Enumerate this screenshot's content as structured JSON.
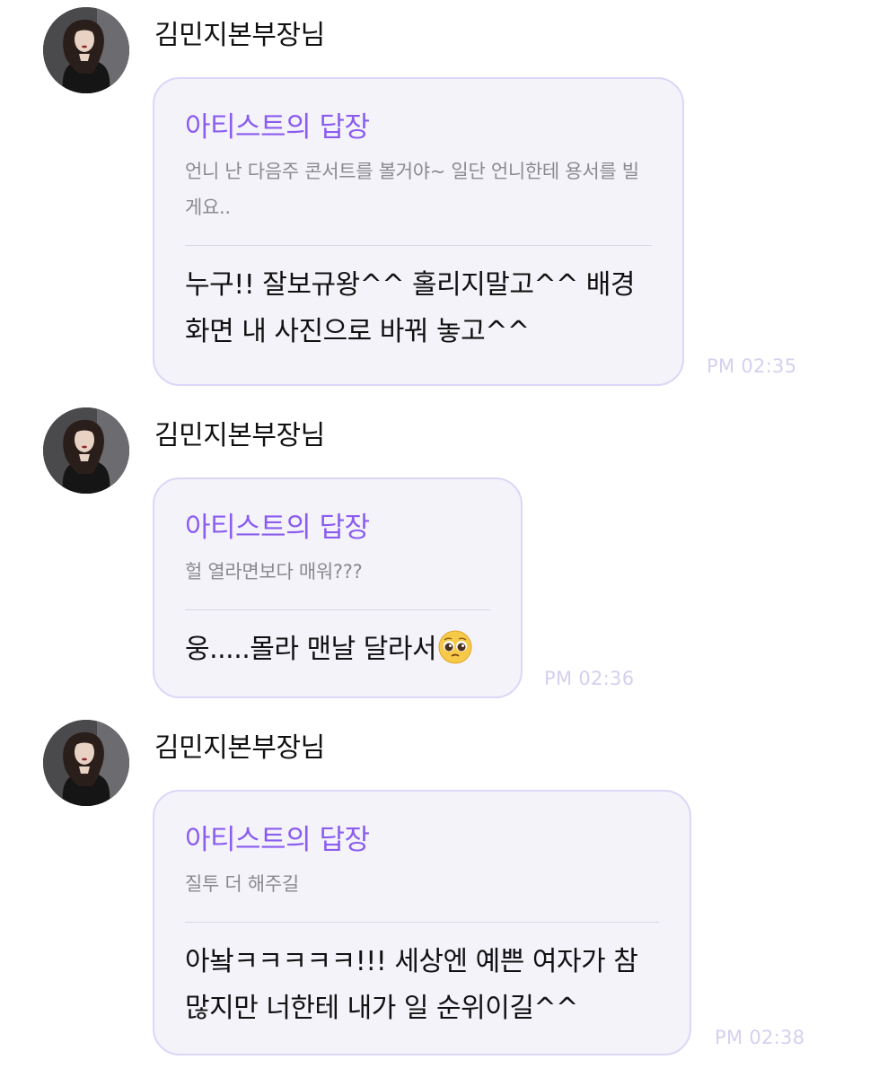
{
  "messages": [
    {
      "sender": "김민지본부장님",
      "reply_title": "아티스트의 답장",
      "quote": "언니 난 다음주 콘서트를 볼거야~ 일단 언니한테 용서를 빌게요..",
      "text": "누구!! 잘보규왕^^ 홀리지말고^^ 배경화면 내 사진으로 바꿔 놓고^^",
      "time": "PM 02:35"
    },
    {
      "sender": "김민지본부장님",
      "reply_title": "아티스트의 답장",
      "quote": "헐 열라면보다 매워???",
      "text": "웅.....몰라 맨날 달라서",
      "emoji": "pleading-face-emoji",
      "time": "PM 02:36"
    },
    {
      "sender": "김민지본부장님",
      "reply_title": "아티스트의 답장",
      "quote": "질투 더 해주길",
      "text": "아놬ㅋㅋㅋㅋㅋ!!! 세상엔 예쁜 여자가 참 많지만 너한테 내가 일 순위이길^^",
      "time": "PM 02:38"
    }
  ],
  "colors": {
    "accent": "#8a5cf0",
    "bubble_bg": "#f4f3fa",
    "bubble_border": "#dcd6f7",
    "time": "#d4d0ef"
  }
}
